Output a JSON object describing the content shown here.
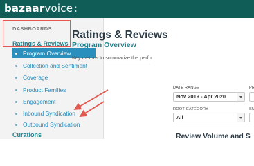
{
  "brand": {
    "bold": "bazaar",
    "light": "voice",
    "colon": ":"
  },
  "sidebar": {
    "dashboards_label": "DASHBOARDS",
    "sections": [
      {
        "title": "Ratings & Reviews",
        "items": [
          {
            "label": "Program Overview",
            "active": true
          },
          {
            "label": "Collection and Sentiment",
            "active": false
          },
          {
            "label": "Coverage",
            "active": false
          },
          {
            "label": "Product Families",
            "active": false
          },
          {
            "label": "Engagement",
            "active": false
          },
          {
            "label": "Inbound Syndication",
            "active": false
          },
          {
            "label": "Outbound Syndication",
            "active": false
          }
        ]
      },
      {
        "title": "Curations",
        "items": []
      }
    ]
  },
  "main": {
    "title": "Ratings & Reviews",
    "subtitle": "Program Overview",
    "description": "Key metrics to summarize the perfo",
    "filters": {
      "date_range": {
        "label": "DATE RANGE",
        "value": "Nov 2019 - Apr 2020"
      },
      "root_category": {
        "label": "ROOT CATEGORY",
        "value": "All"
      },
      "col2_label_1": "PR",
      "col2_label_2": "SU"
    },
    "section_heading": "Review Volume and S"
  },
  "annotation": {
    "highlight_color": "#e0584f",
    "arrow_color": "#e0584f"
  },
  "colors": {
    "topbar": "#0f5d56",
    "active_item": "#2a8fbd",
    "link": "#2589bb",
    "section_title": "#20808d"
  }
}
